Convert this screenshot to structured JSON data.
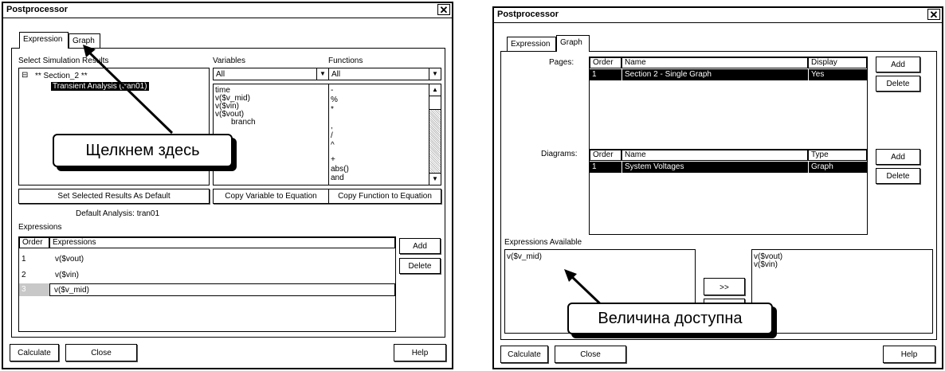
{
  "left": {
    "title": "Postprocessor",
    "close_symbol": "✕",
    "tabs": [
      "Expression",
      "Graph"
    ],
    "select_label": "Select Simulation Results",
    "tree_root": "** Section_2 **",
    "tree_child": "Transient Analysis (tran01)",
    "variables_label": "Variables",
    "variables_filter": "All",
    "variables": [
      "time",
      "v($v_mid)",
      "v($vin)",
      "v($vout)",
      "branch"
    ],
    "functions_label": "Functions",
    "functions_filter": "All",
    "functions": [
      "-",
      "%",
      "*",
      ",",
      "/",
      "^",
      "+",
      "abs()",
      "and"
    ],
    "set_default_btn": "Set Selected Results As Default",
    "copy_variable_btn": "Copy Variable to Equation",
    "copy_function_btn": "Copy Function to Equation",
    "default_analysis": "Default Analysis: tran01",
    "expressions_label": "Expressions",
    "col_order": "Order",
    "col_expressions": "Expressions",
    "rows": [
      {
        "order": "1",
        "expr": "v($vout)"
      },
      {
        "order": "2",
        "expr": "v($vin)"
      },
      {
        "order": "3",
        "expr": "v($v_mid)"
      }
    ],
    "add_btn": "Add",
    "delete_btn": "Delete",
    "calculate_btn": "Calculate",
    "close_btn": "Close",
    "help_btn": "Help",
    "callout": "Щелкнем здесь"
  },
  "right": {
    "title": "Postprocessor",
    "close_symbol": "✕",
    "tabs": [
      "Expression",
      "Graph"
    ],
    "pages_label": "Pages:",
    "pages_cols": [
      "Order",
      "Name",
      "Display"
    ],
    "pages_row": {
      "order": "1",
      "name": "Section 2 - Single Graph",
      "display": "Yes"
    },
    "diagrams_label": "Diagrams:",
    "diagrams_cols": [
      "Order",
      "Name",
      "Type"
    ],
    "diagrams_row": {
      "order": "1",
      "name": "System Voltages",
      "type": "Graph"
    },
    "add_btn": "Add",
    "delete_btn": "Delete",
    "expr_available_label": "Expressions Available",
    "available": [
      "v($v_mid)"
    ],
    "selected": [
      "v($vout)",
      "v($vin)"
    ],
    "move_right": ">>",
    "move_left": "<<",
    "calculate_btn": "Calculate",
    "close_btn": "Close",
    "help_btn": "Help",
    "callout": "Величина доступна"
  }
}
